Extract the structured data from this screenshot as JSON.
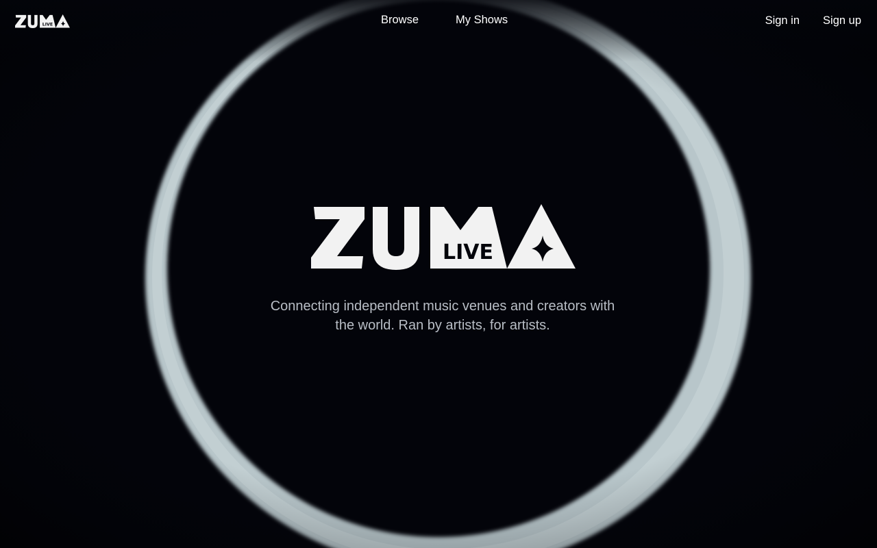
{
  "brand": {
    "wordmark": "ZUMA",
    "sub_mark": "LIVE",
    "logo_icon": "four-point-star-icon"
  },
  "nav": {
    "center_links": [
      {
        "label": "Browse"
      },
      {
        "label": "My Shows"
      }
    ],
    "sign_in_label": "Sign in",
    "sign_up_label": "Sign up"
  },
  "hero": {
    "tagline": "Connecting independent music venues and creators with the world. Ran by artists, for artists."
  },
  "colors": {
    "background": "#03040a",
    "ring": "#b8c6ca",
    "text_primary": "#ffffff",
    "text_secondary": "#b9bec6"
  }
}
